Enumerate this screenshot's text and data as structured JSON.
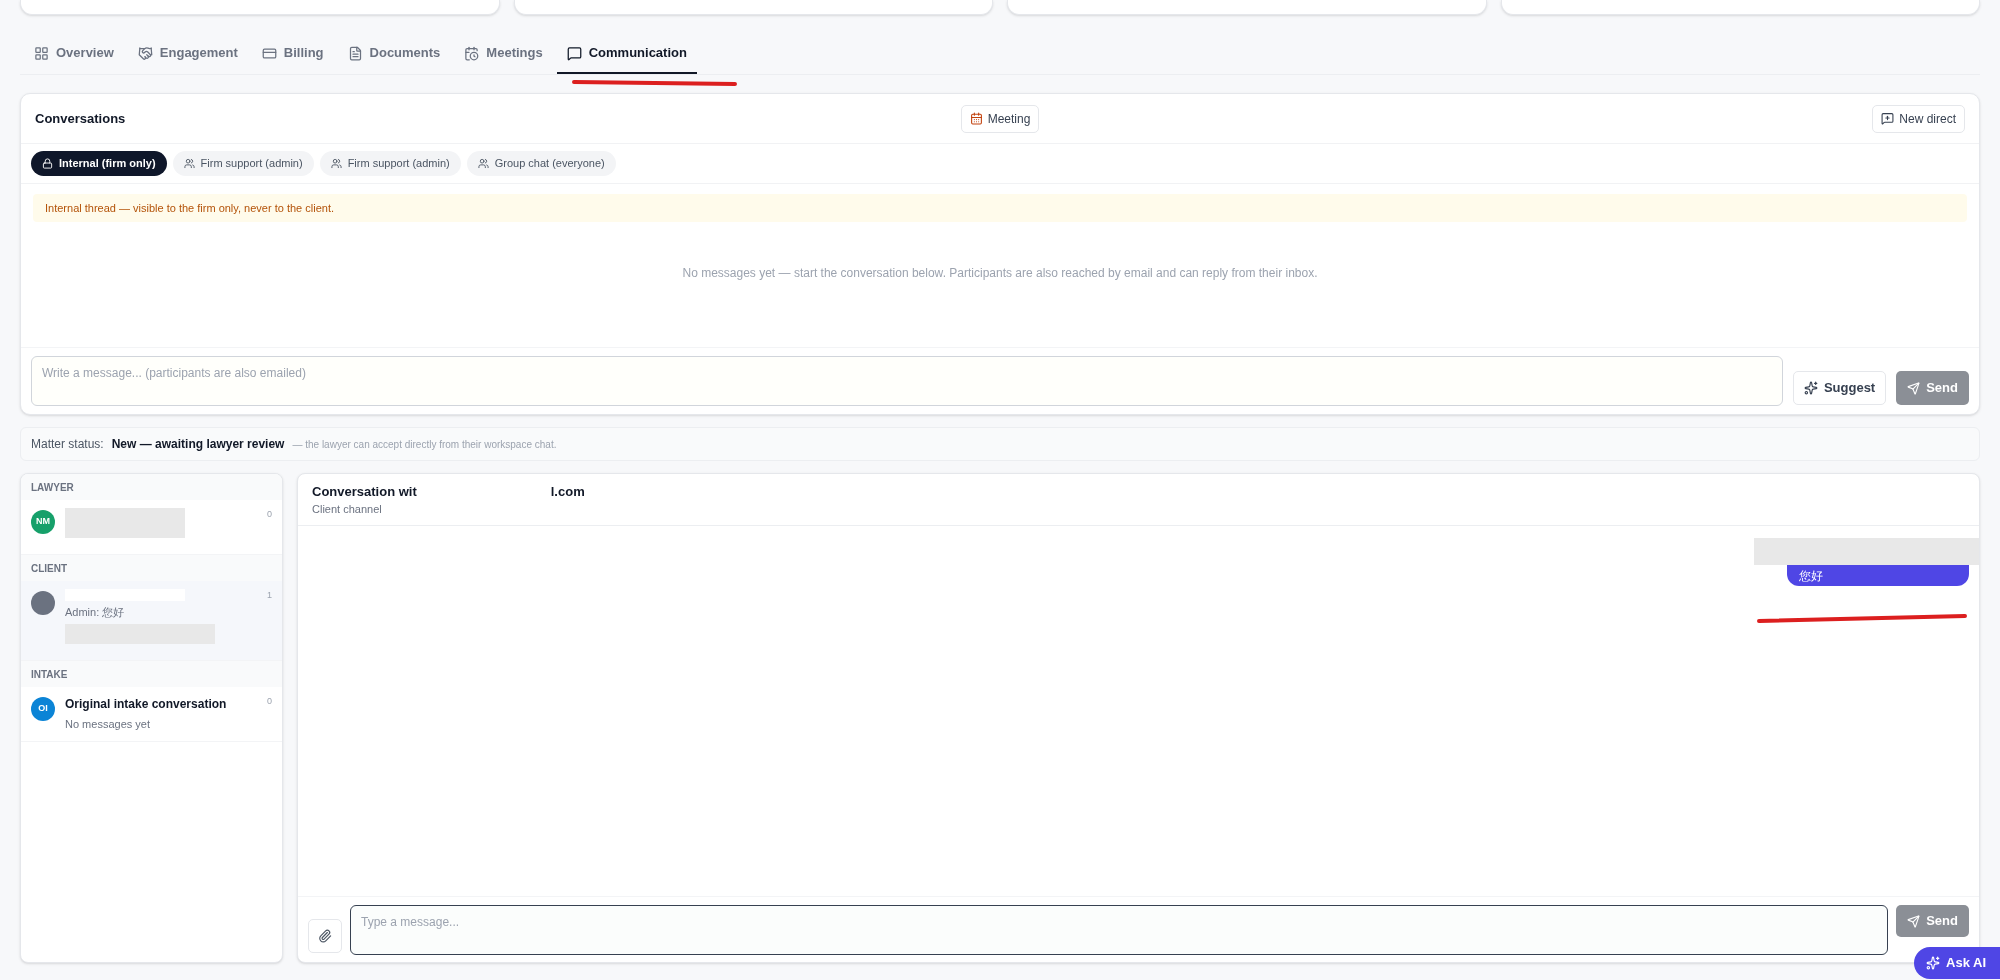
{
  "tabs": [
    {
      "label": "Overview",
      "selected": false
    },
    {
      "label": "Engagement",
      "selected": false
    },
    {
      "label": "Billing",
      "selected": false
    },
    {
      "label": "Documents",
      "selected": false
    },
    {
      "label": "Meetings",
      "selected": false
    },
    {
      "label": "Communication",
      "selected": true
    }
  ],
  "conversations": {
    "title": "Conversations",
    "meeting_button": "Meeting",
    "new_direct_button": "New direct",
    "channels": [
      {
        "label": "Internal (firm only)",
        "kind": "lock",
        "selected": true
      },
      {
        "label": "Firm support (admin)",
        "kind": "people",
        "selected": false
      },
      {
        "label": "Firm support (admin)",
        "kind": "people",
        "selected": false
      },
      {
        "label": "Group chat (everyone)",
        "kind": "people",
        "selected": false
      }
    ],
    "notice": "Internal thread — visible to the firm only, never to the client.",
    "empty_text": "No messages yet — start the conversation below. Participants are also reached by email and can reply from their inbox.",
    "composer": {
      "placeholder": "Write a message... (participants are also emailed)"
    },
    "suggest_button": "Suggest",
    "send_button": "Send"
  },
  "matter_status": {
    "label": "Matter status:",
    "value": "New — awaiting lawyer review",
    "note": "— the lawyer can accept directly from their workspace chat."
  },
  "sidebar": {
    "groups": [
      {
        "heading": "LAWYER",
        "items": [
          {
            "initials": "NM",
            "color": "#16a06a",
            "redacted": true,
            "count": "0",
            "selected": false
          }
        ]
      },
      {
        "heading": "CLIENT",
        "items": [
          {
            "color": "#6b7280",
            "redacted": true,
            "preview": "Admin: 您好",
            "count": "1",
            "selected": true
          }
        ]
      },
      {
        "heading": "INTAKE",
        "items": [
          {
            "initials": "OI",
            "color": "#0b84d6",
            "redacted": false,
            "title": "Original intake conversation",
            "preview": "No messages yet",
            "count": "0",
            "selected": false
          }
        ]
      }
    ]
  },
  "chat": {
    "title_start": "Conversation wit",
    "title_end": "l.com",
    "subtitle": "Client channel",
    "messages": [
      {
        "text": "您好",
        "outgoing": true
      }
    ],
    "composer": {
      "placeholder": "Type a message..."
    },
    "send_button": "Send"
  },
  "ask_ai_button": "Ask AI"
}
